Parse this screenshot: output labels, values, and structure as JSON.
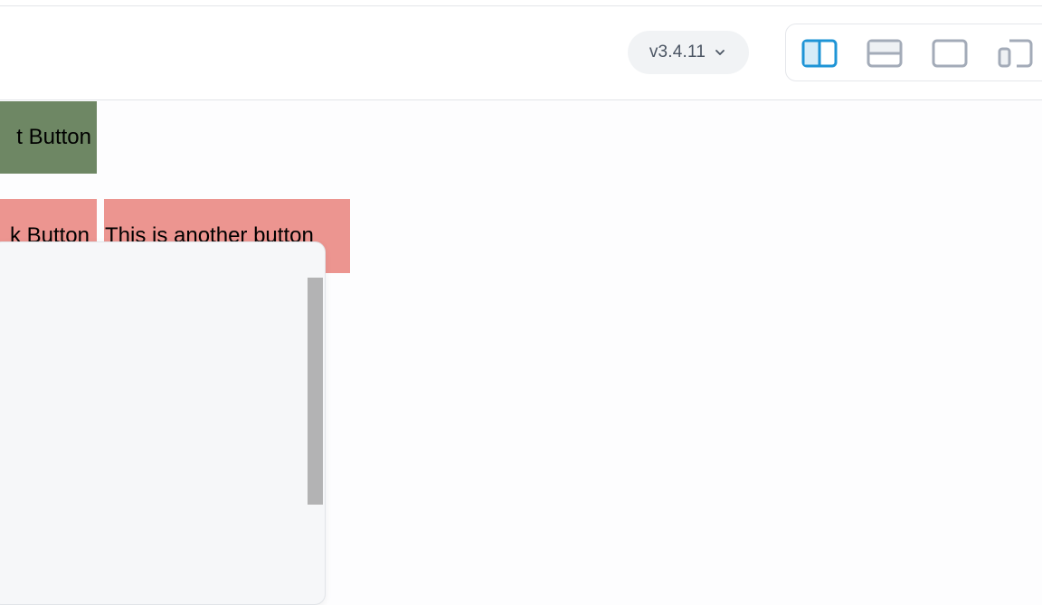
{
  "toolbar": {
    "version_label": "v3.4.11",
    "layout_buttons": [
      {
        "name": "split-vertical",
        "active": true
      },
      {
        "name": "split-horizontal",
        "active": false
      },
      {
        "name": "preview-only",
        "active": false
      },
      {
        "name": "picture-in-picture",
        "active": false
      }
    ]
  },
  "preview": {
    "green_button_label": "t Button",
    "red_button_1_label": "k Button",
    "red_button_2_label": "This is another button"
  },
  "colors": {
    "accent": "#1e94d6",
    "inactive_icon": "#a3abb8",
    "green_button": "#6e8764",
    "red_button": "#ec9590"
  }
}
